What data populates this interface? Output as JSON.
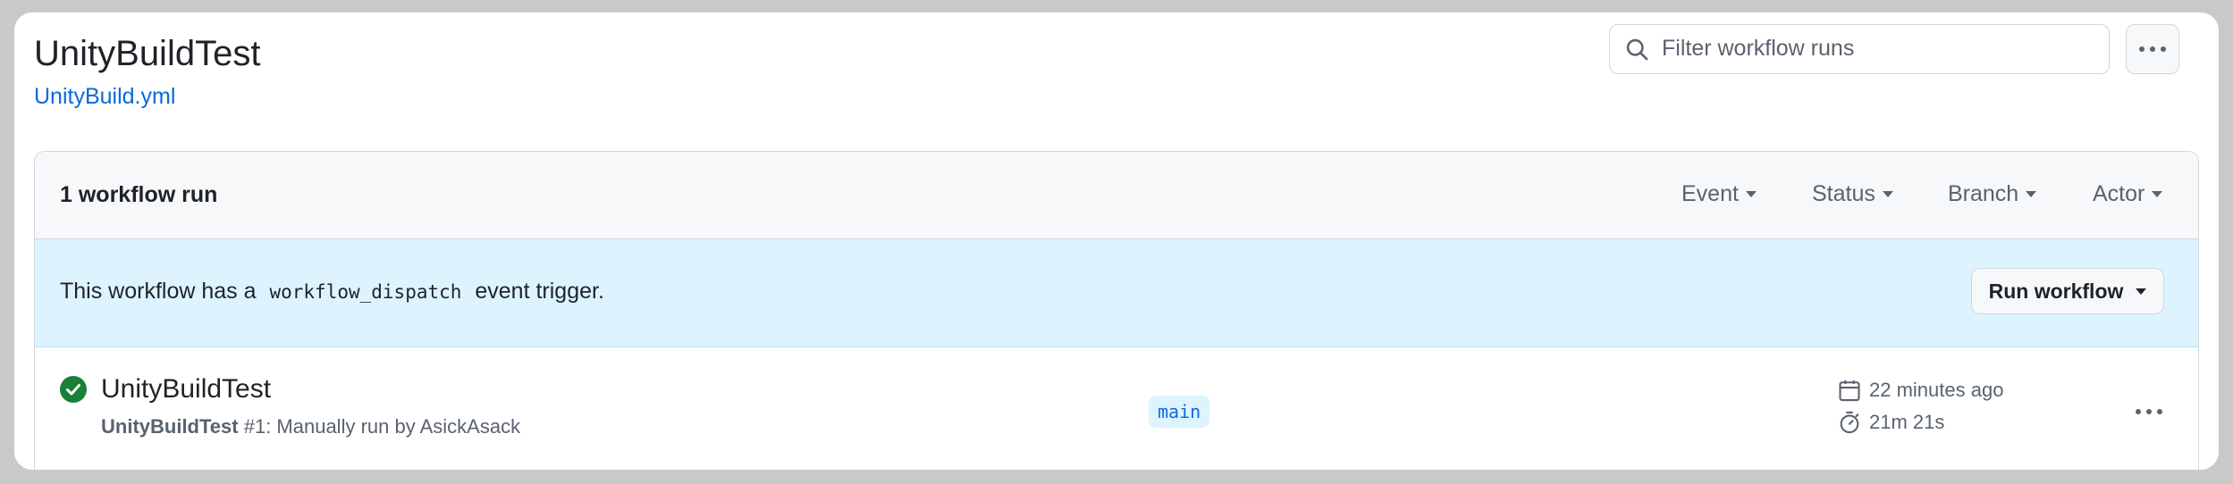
{
  "header": {
    "title": "UnityBuildTest",
    "workflow_file": "UnityBuild.yml"
  },
  "search": {
    "placeholder": "Filter workflow runs",
    "icon": "search-icon"
  },
  "more_menu": {
    "icon": "kebab-horizontal-icon"
  },
  "runs_header": {
    "count_label": "1 workflow run",
    "filters": [
      "Event",
      "Status",
      "Branch",
      "Actor"
    ]
  },
  "banner": {
    "prefix": "This workflow has a",
    "code": "workflow_dispatch",
    "suffix": "event trigger.",
    "button_label": "Run workflow"
  },
  "runs": [
    {
      "status": "success",
      "status_icon": "check-circle-icon",
      "title": "UnityBuildTest",
      "workflow_name": "UnityBuildTest",
      "run_info": "#1: Manually run by AsickAsack",
      "branch": "main",
      "time_ago": "22 minutes ago",
      "duration": "21m 21s"
    }
  ],
  "colors": {
    "accent": "#0969da",
    "success": "#1a7f37",
    "banner_bg": "#ddf4ff",
    "header_bg": "#f6f8fa"
  }
}
